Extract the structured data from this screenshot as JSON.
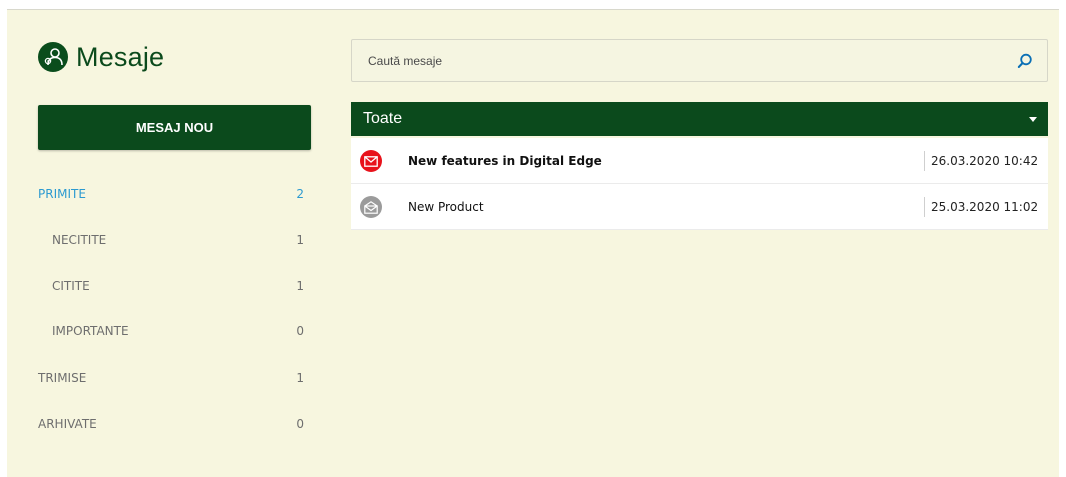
{
  "header": {
    "title": "Mesaje",
    "icon": "user-gear-icon"
  },
  "actions": {
    "new_message_label": "MESAJ NOU"
  },
  "sidebar": {
    "folders": [
      {
        "label": "PRIMITE",
        "count": "2"
      },
      {
        "label": "NECITITE",
        "count": "1"
      },
      {
        "label": "CITITE",
        "count": "1"
      },
      {
        "label": "IMPORTANTE",
        "count": "0"
      },
      {
        "label": "TRIMISE",
        "count": "1"
      },
      {
        "label": "ARHIVATE",
        "count": "0"
      }
    ]
  },
  "search": {
    "placeholder": "Caută mesaje",
    "value": ""
  },
  "filter": {
    "selected": "Toate"
  },
  "messages": [
    {
      "subject": "New features in Digital Edge",
      "date": "26.03.2020 10:42",
      "status": "unread",
      "icon": "envelope-closed-icon"
    },
    {
      "subject": "New Product",
      "date": "25.03.2020 11:02",
      "status": "read",
      "icon": "envelope-open-icon"
    }
  ],
  "colors": {
    "brand_green": "#0b4a1c",
    "background": "#f7f6df",
    "active_link": "#2c9ad0",
    "unread_icon": "#e8121b",
    "read_icon": "#9b9b9b"
  }
}
